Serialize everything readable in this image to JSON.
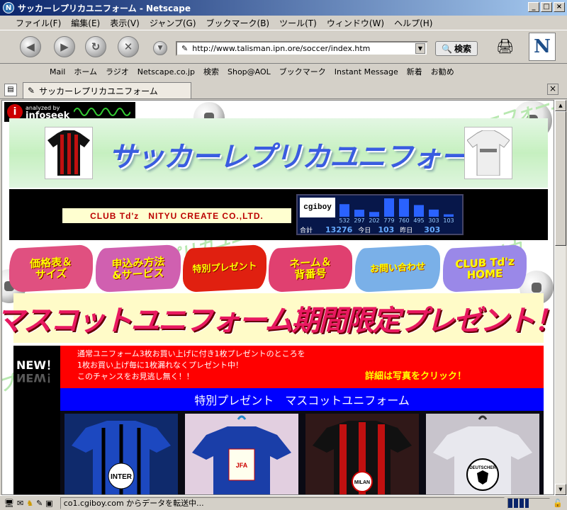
{
  "window": {
    "title": "サッカーレプリカユニフォーム - Netscape"
  },
  "menu": [
    "ファイル(F)",
    "編集(E)",
    "表示(V)",
    "ジャンプ(G)",
    "ブックマーク(B)",
    "ツール(T)",
    "ウィンドウ(W)",
    "ヘルプ(H)"
  ],
  "nav": {
    "url": "http://www.talisman.ipn.ore/soccer/index.htm",
    "search_label": "検索"
  },
  "bookmarks": [
    "Mail",
    "ホーム",
    "ラジオ",
    "Netscape.co.jp",
    "検索",
    "Shop@AOL",
    "ブックマーク",
    "Instant Message",
    "新着",
    "お勧め"
  ],
  "tab": {
    "title": "サッカーレプリカユニフォーム"
  },
  "page": {
    "infoseek_top": "analyzed by",
    "infoseek_name": "infoseek",
    "banner_title": "サッカーレプリカユニフォーム",
    "club_name": "CLUB Td'z　NITYU CREATE CO.,LTD.",
    "counter": {
      "logo": "cgiboy",
      "bars": [
        532,
        297,
        202,
        779,
        760,
        495,
        303,
        103
      ],
      "bar_labels": [
        "532",
        "297",
        "202",
        "779",
        "760",
        "495",
        "303",
        "103"
      ],
      "total_label": "合計",
      "total": "13276",
      "today_label": "今日",
      "today": "103",
      "yesterday_label": "昨日",
      "yesterday": "303"
    },
    "nav_links": [
      {
        "label1": "価格表＆",
        "label2": "サイズ",
        "color": "#e05080"
      },
      {
        "label1": "申込み方法",
        "label2": "&サービス",
        "color": "#d060b0"
      },
      {
        "label1": "特別プレゼント",
        "label2": "",
        "color": "#e02010"
      },
      {
        "label1": "ネーム＆",
        "label2": "背番号",
        "color": "#e04070"
      },
      {
        "label1": "お問い合わせ",
        "label2": "",
        "color": "#7ab0e8"
      },
      {
        "label1": "CLUB Td'z",
        "label2": "HOME",
        "color": "#9a88e8"
      }
    ],
    "promo_title": "マスコットユニフォーム期間限定プレゼント！",
    "new_label": "NEW！",
    "promo_lines": [
      "通常ユニフォーム3枚お買い上げに付き1枚プレゼントのところを",
      "1枚お買い上げ毎に1枚漏れなくプレゼント中！",
      "このチャンスをお見逃し無く！！"
    ],
    "detail_text": "詳細は写真をクリック！",
    "section_title": "特別プレゼント　マスコットユニフォーム",
    "photos": [
      "INTER",
      "JFA",
      "MILAN",
      "DEUTSCHER"
    ]
  },
  "status": {
    "text": "co1.cgiboy.com からデータを転送中..."
  }
}
